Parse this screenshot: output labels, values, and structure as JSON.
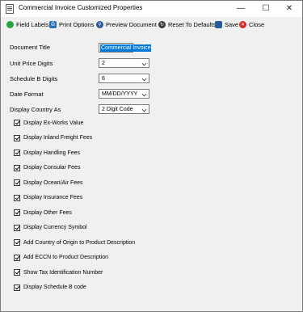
{
  "window": {
    "title": "Commercial Invoice Customized Properties"
  },
  "toolbar": {
    "items": [
      {
        "label": "Field Labels",
        "icon": "green-circle-icon",
        "color": "#27a341"
      },
      {
        "label": "Print Options",
        "icon": "printer-icon",
        "color": "#2a6fb8"
      },
      {
        "label": "Preview Document",
        "icon": "preview-icon",
        "color": "#2a5a9a"
      },
      {
        "label": "Reset To Defaults",
        "icon": "reset-icon",
        "color": "#3a3a3a"
      },
      {
        "label": "Save",
        "icon": "save-icon",
        "color": "#2a5a9a"
      },
      {
        "label": "Close",
        "icon": "close-icon",
        "color": "#d42a2a"
      }
    ]
  },
  "form": {
    "document_title": {
      "label": "Document Title",
      "value": "Commercial Invoice"
    },
    "unit_price_digits": {
      "label": "Unit Price Digits",
      "value": "2"
    },
    "schedule_b_digits": {
      "label": "Schedule B Digits",
      "value": "6"
    },
    "date_format": {
      "label": "Date Format",
      "value": "MM/DD/YYYY"
    },
    "display_country_as": {
      "label": "Display Country As",
      "value": "2 Digit Code"
    }
  },
  "checkboxes": [
    {
      "label": "Display Ex-Works Value",
      "checked": true
    },
    {
      "label": "Display Inland Freight Fees",
      "checked": true
    },
    {
      "label": "Display Handling Fees",
      "checked": true
    },
    {
      "label": "Display Consular Fees",
      "checked": true
    },
    {
      "label": "Display Ocean/Air Fees",
      "checked": true
    },
    {
      "label": "Display Insurance Fees",
      "checked": true
    },
    {
      "label": "Display Other Fees",
      "checked": true
    },
    {
      "label": "Display Currency Symbol",
      "checked": true
    },
    {
      "label": "Add Country of Origin to Product Description",
      "checked": true
    },
    {
      "label": "Add ECCN to Product Description",
      "checked": true
    },
    {
      "label": "Show Tax Identification Number",
      "checked": true
    },
    {
      "label": "Display Schedule B code",
      "checked": true
    }
  ]
}
